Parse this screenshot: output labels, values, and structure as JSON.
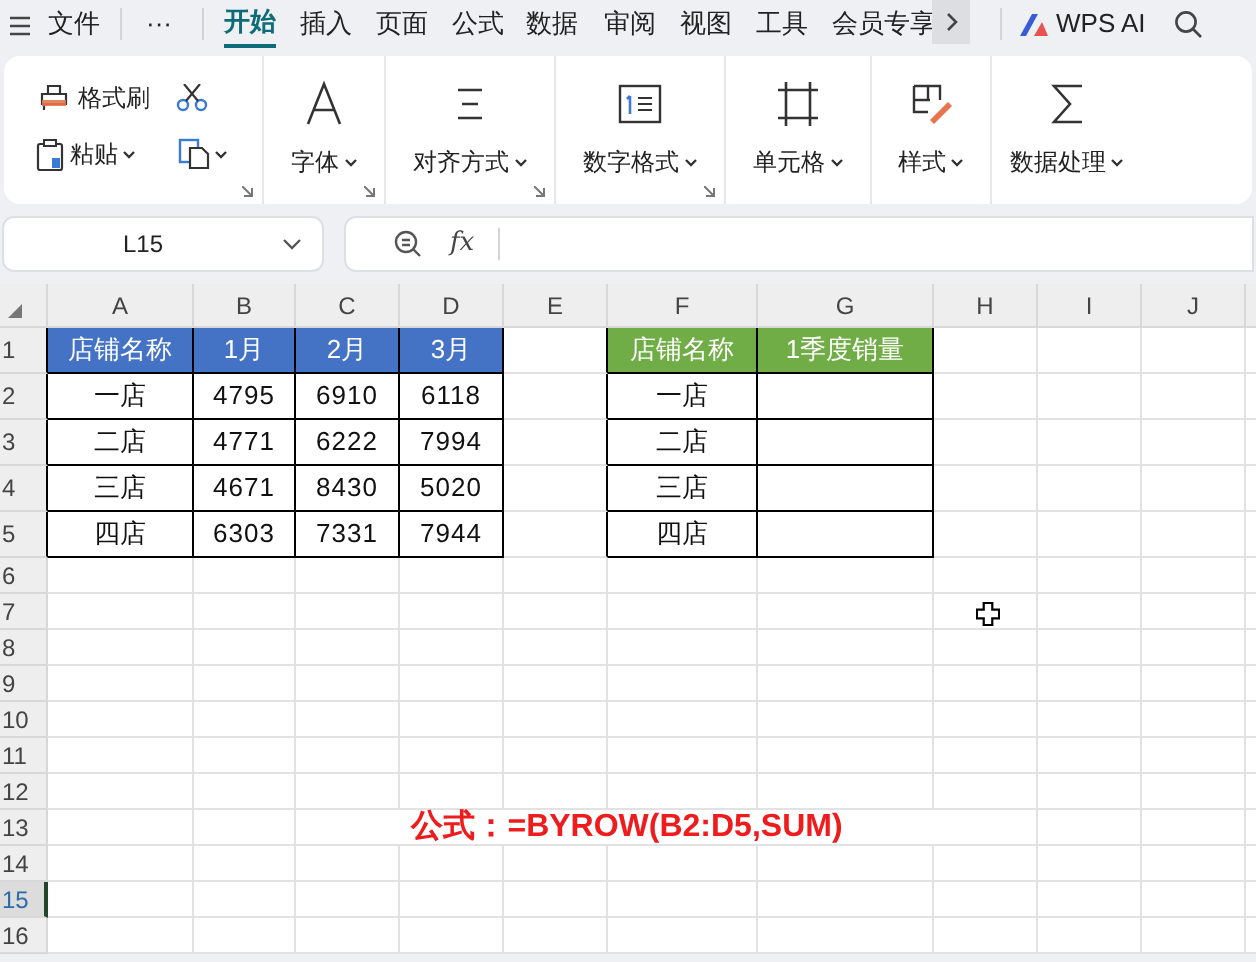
{
  "menu_bar": {
    "items": [
      {
        "label": "文件",
        "selected": false
      },
      {
        "label": "···",
        "selected": false
      },
      {
        "label": "开始",
        "selected": true
      },
      {
        "label": "插入",
        "selected": false
      },
      {
        "label": "页面",
        "selected": false
      },
      {
        "label": "公式",
        "selected": false
      },
      {
        "label": "数据",
        "selected": false
      },
      {
        "label": "审阅",
        "selected": false
      },
      {
        "label": "视图",
        "selected": false
      },
      {
        "label": "工具",
        "selected": false
      },
      {
        "label": "会员专享",
        "selected": false
      }
    ],
    "ai_button": "WPS AI"
  },
  "ribbon": {
    "clipboard": {
      "format_painter": "格式刷",
      "paste": "粘贴"
    },
    "groups": [
      {
        "label": "字体",
        "kind": "font",
        "launcher": true
      },
      {
        "label": "对齐方式",
        "kind": "align",
        "launcher": true
      },
      {
        "label": "数字格式",
        "kind": "number",
        "launcher": true
      },
      {
        "label": "单元格",
        "kind": "cell",
        "launcher": false
      },
      {
        "label": "样式",
        "kind": "style",
        "launcher": false
      },
      {
        "label": "数据处理",
        "kind": "sum",
        "launcher": false
      }
    ]
  },
  "name_box": "L15",
  "formula_bar": {
    "fx": "fx"
  },
  "sheet": {
    "columns": [
      "A",
      "B",
      "C",
      "D",
      "E",
      "F",
      "G",
      "H",
      "I",
      "J"
    ],
    "rows": [
      {
        "number": "1",
        "selected": false
      },
      {
        "number": "2",
        "selected": false
      },
      {
        "number": "3",
        "selected": false
      },
      {
        "number": "4",
        "selected": false
      },
      {
        "number": "5",
        "selected": false
      },
      {
        "number": "6",
        "selected": false
      },
      {
        "number": "7",
        "selected": false
      },
      {
        "number": "8",
        "selected": false
      },
      {
        "number": "9",
        "selected": false
      },
      {
        "number": "10",
        "selected": false
      },
      {
        "number": "11",
        "selected": false
      },
      {
        "number": "12",
        "selected": false
      },
      {
        "number": "13",
        "selected": false
      },
      {
        "number": "14",
        "selected": false
      },
      {
        "number": "15",
        "selected": true
      },
      {
        "number": "16",
        "selected": false
      }
    ],
    "tables": [
      {
        "color": "#4472c4",
        "columns": [
          "店铺名称",
          "1月",
          "2月",
          "3月"
        ],
        "rows": [
          [
            "一店",
            "4795",
            "6910",
            "6118"
          ],
          [
            "二店",
            "4771",
            "6222",
            "7994"
          ],
          [
            "三店",
            "4671",
            "8430",
            "5020"
          ],
          [
            "四店",
            "6303",
            "7331",
            "7944"
          ]
        ]
      },
      {
        "color": "#70ad47",
        "columns": [
          "店铺名称",
          "1季度销量"
        ],
        "rows": [
          [
            "一店"
          ],
          [
            "二店"
          ],
          [
            "三店"
          ],
          [
            "四店"
          ]
        ]
      }
    ],
    "note": "公式：=BYROW(B2:D5,SUM)"
  }
}
